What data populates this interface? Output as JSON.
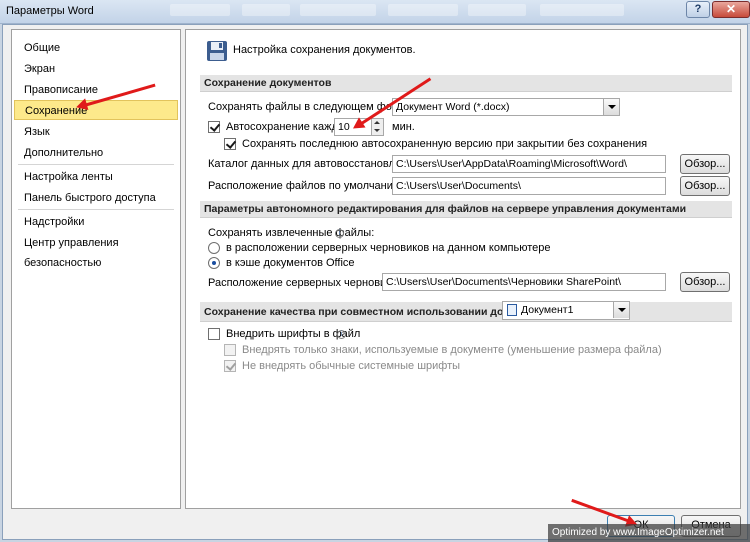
{
  "window": {
    "title": "Параметры Word",
    "help_glyph": "?",
    "close_glyph": "✕"
  },
  "nav": {
    "items": [
      {
        "label": "Общие"
      },
      {
        "label": "Экран"
      },
      {
        "label": "Правописание"
      },
      {
        "label": "Сохранение",
        "active": true
      },
      {
        "label": "Язык"
      },
      {
        "label": "Дополнительно"
      },
      {
        "label": "Настройка ленты"
      },
      {
        "label": "Панель быстрого доступа"
      },
      {
        "label": "Надстройки"
      },
      {
        "label": "Центр управления безопасностью"
      }
    ]
  },
  "main": {
    "header": "Настройка сохранения документов.",
    "save_docs": {
      "section_title": "Сохранение документов",
      "format_label": "Сохранять файлы в следующем формате:",
      "format_value": "Документ Word (*.docx)",
      "autosave_label": "Автосохранение каждые",
      "autosave_value": "10",
      "autosave_unit": "мин.",
      "autosave_checked": true,
      "keep_last_label": "Сохранять последнюю автосохраненную версию при закрытии без сохранения",
      "keep_last_checked": true,
      "autorecover_label": "Каталог данных для автовосстановления:",
      "autorecover_value": "C:\\Users\\User\\AppData\\Roaming\\Microsoft\\Word\\",
      "default_loc_label": "Расположение файлов по умолчанию:",
      "default_loc_value": "C:\\Users\\User\\Documents\\",
      "browse_label": "Обзор..."
    },
    "offline": {
      "section_title": "Параметры автономного редактирования для файлов на сервере управления документами",
      "save_checked_out_label": "Сохранять извлеченные файлы:",
      "info_glyph": "i",
      "option_server": "в расположении серверных черновиков на данном компьютере",
      "option_cache": "в кэше документов Office",
      "selected_option": "cache",
      "drafts_label": "Расположение серверных черновиков:",
      "drafts_value": "C:\\Users\\User\\Documents\\Черновики SharePoint\\",
      "browse_label": "Обзор..."
    },
    "fidelity": {
      "section_title": "Сохранение качества при совместном использовании документа:",
      "doc_value": "Документ1",
      "embed_fonts_label": "Внедрить шрифты в файл",
      "embed_fonts_checked": false,
      "info_glyph": "i",
      "only_used_chars_label": "Внедрять только знаки, используемые в документе (уменьшение размера файла)",
      "only_used_chars_checked": false,
      "skip_system_fonts_label": "Не внедрять обычные системные шрифты",
      "skip_system_fonts_checked": true
    }
  },
  "footer": {
    "ok_label": "ОК",
    "cancel_label": "Отмена"
  },
  "watermark": "Optimized by www.ImageOptimizer.net",
  "colors": {
    "active_nav": "#fde98b",
    "annotation_arrow": "#e01a1a",
    "titlebar": "#c2d3e8"
  }
}
